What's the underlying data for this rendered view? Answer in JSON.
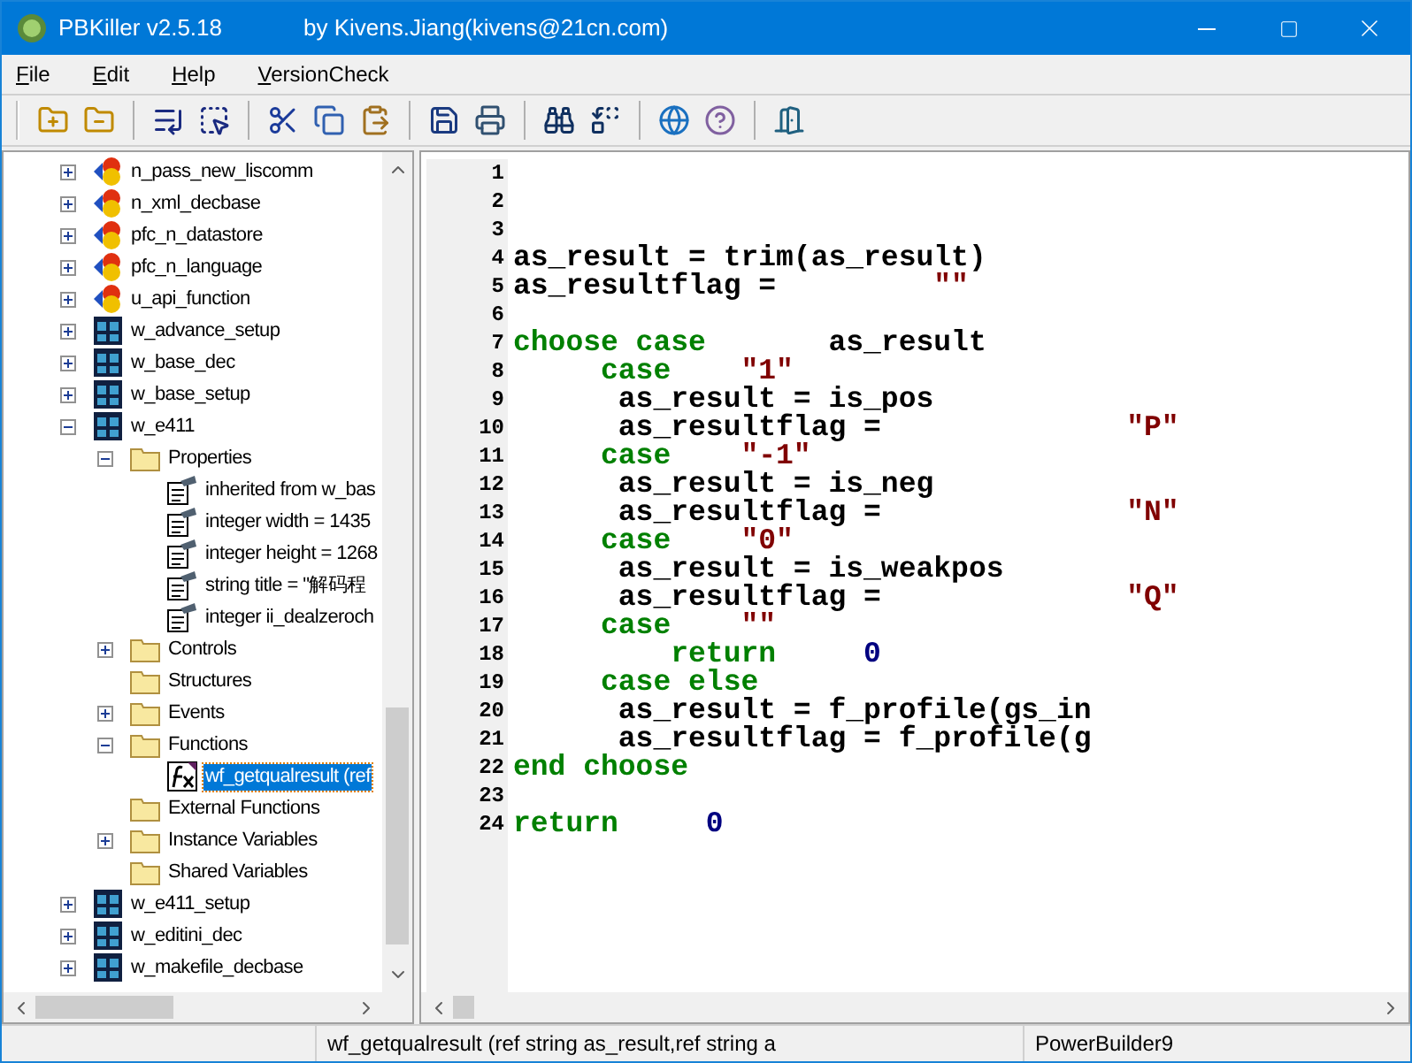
{
  "window": {
    "title": "PBKiller v2.5.18",
    "subtitle": "by Kivens.Jiang(kivens@21cn.com)"
  },
  "menu": [
    "File",
    "Edit",
    "Help",
    "VersionCheck"
  ],
  "tree": [
    {
      "label": "n_pass_new_liscomm",
      "kind": "object",
      "expanded": false
    },
    {
      "label": "n_xml_decbase",
      "kind": "object",
      "expanded": false
    },
    {
      "label": "pfc_n_datastore",
      "kind": "object",
      "expanded": false
    },
    {
      "label": "pfc_n_language",
      "kind": "object",
      "expanded": false
    },
    {
      "label": "u_api_function",
      "kind": "object",
      "expanded": false
    },
    {
      "label": "w_advance_setup",
      "kind": "window",
      "expanded": false
    },
    {
      "label": "w_base_dec",
      "kind": "window",
      "expanded": false
    },
    {
      "label": "w_base_setup",
      "kind": "window",
      "expanded": false
    },
    {
      "label": "w_e411",
      "kind": "window",
      "expanded": true,
      "children": [
        {
          "label": "Properties",
          "kind": "folder",
          "expanded": true,
          "children": [
            {
              "label": "inherited from w_bas",
              "kind": "property"
            },
            {
              "label": "integer width = 1435",
              "kind": "property"
            },
            {
              "label": "integer height = 1268",
              "kind": "property"
            },
            {
              "label": "string title = \"解码程",
              "kind": "property"
            },
            {
              "label": "integer ii_dealzeroch",
              "kind": "property"
            }
          ]
        },
        {
          "label": "Controls",
          "kind": "folder",
          "expanded": false
        },
        {
          "label": "Structures",
          "kind": "folder"
        },
        {
          "label": "Events",
          "kind": "folder",
          "expanded": false
        },
        {
          "label": "Functions",
          "kind": "folder",
          "expanded": true,
          "children": [
            {
              "label": "wf_getqualresult (ref",
              "kind": "function",
              "selected": true
            }
          ]
        },
        {
          "label": "External Functions",
          "kind": "folder"
        },
        {
          "label": "Instance Variables",
          "kind": "folder",
          "expanded": false
        },
        {
          "label": "Shared Variables",
          "kind": "folder"
        }
      ]
    },
    {
      "label": "w_e411_setup",
      "kind": "window",
      "expanded": false
    },
    {
      "label": "w_editini_dec",
      "kind": "window",
      "expanded": false
    },
    {
      "label": "w_makefile_decbase",
      "kind": "window",
      "expanded": false
    }
  ],
  "code": [
    {
      "number": "1"
    },
    {
      "number": "2"
    },
    {
      "number": "3"
    },
    {
      "number": "4",
      "tokens": [
        {
          "text": "as_result = trim(as_result)",
          "kind": "plain"
        }
      ]
    },
    {
      "number": "5",
      "tokens": [
        {
          "text": "as_resultflag =         ",
          "kind": "plain"
        },
        {
          "text": "\"\"",
          "kind": "string"
        }
      ]
    },
    {
      "number": "6"
    },
    {
      "number": "7",
      "tokens": [
        {
          "text": "choose case",
          "kind": "keyword"
        },
        {
          "text": "       as_result",
          "kind": "plain"
        }
      ]
    },
    {
      "number": "8",
      "tokens": [
        {
          "text": "     case",
          "kind": "keyword"
        },
        {
          "text": "    \"1\"",
          "kind": "string"
        }
      ]
    },
    {
      "number": "9",
      "tokens": [
        {
          "text": "      as_result = is_pos",
          "kind": "plain"
        }
      ]
    },
    {
      "number": "10",
      "tokens": [
        {
          "text": "      as_resultflag =           ",
          "kind": "plain"
        },
        {
          "text": "   \"P\"",
          "kind": "string"
        }
      ]
    },
    {
      "number": "11",
      "tokens": [
        {
          "text": "     case",
          "kind": "keyword"
        },
        {
          "text": "    \"-1\"",
          "kind": "string"
        }
      ]
    },
    {
      "number": "12",
      "tokens": [
        {
          "text": "      as_result = is_neg",
          "kind": "plain"
        }
      ]
    },
    {
      "number": "13",
      "tokens": [
        {
          "text": "      as_resultflag =           ",
          "kind": "plain"
        },
        {
          "text": "   \"N\"",
          "kind": "string"
        }
      ]
    },
    {
      "number": "14",
      "tokens": [
        {
          "text": "     case",
          "kind": "keyword"
        },
        {
          "text": "    \"0\"",
          "kind": "string"
        }
      ]
    },
    {
      "number": "15",
      "tokens": [
        {
          "text": "      as_result = is_weakpos",
          "kind": "plain"
        }
      ]
    },
    {
      "number": "16",
      "tokens": [
        {
          "text": "      as_resultflag =           ",
          "kind": "plain"
        },
        {
          "text": "   \"Q\"",
          "kind": "string"
        }
      ]
    },
    {
      "number": "17",
      "tokens": [
        {
          "text": "     case",
          "kind": "keyword"
        },
        {
          "text": "    \"\"",
          "kind": "string"
        }
      ]
    },
    {
      "number": "18",
      "tokens": [
        {
          "text": "         return",
          "kind": "keyword"
        },
        {
          "text": "     0",
          "kind": "number"
        }
      ]
    },
    {
      "number": "19",
      "tokens": [
        {
          "text": "     case else",
          "kind": "keyword"
        }
      ]
    },
    {
      "number": "20",
      "tokens": [
        {
          "text": "      as_result = f_profile(gs_in",
          "kind": "plain"
        }
      ]
    },
    {
      "number": "21",
      "tokens": [
        {
          "text": "      as_resultflag = f_profile(g",
          "kind": "plain"
        }
      ]
    },
    {
      "number": "22",
      "tokens": [
        {
          "text": "end choose",
          "kind": "keyword"
        }
      ]
    },
    {
      "number": "23"
    },
    {
      "number": "24",
      "tokens": [
        {
          "text": "return",
          "kind": "keyword"
        },
        {
          "text": "     0",
          "kind": "number"
        }
      ]
    }
  ],
  "status_bar": {
    "left": "wf_getqualresult (ref string as_result,ref string a",
    "right": "PowerBuilder9"
  }
}
